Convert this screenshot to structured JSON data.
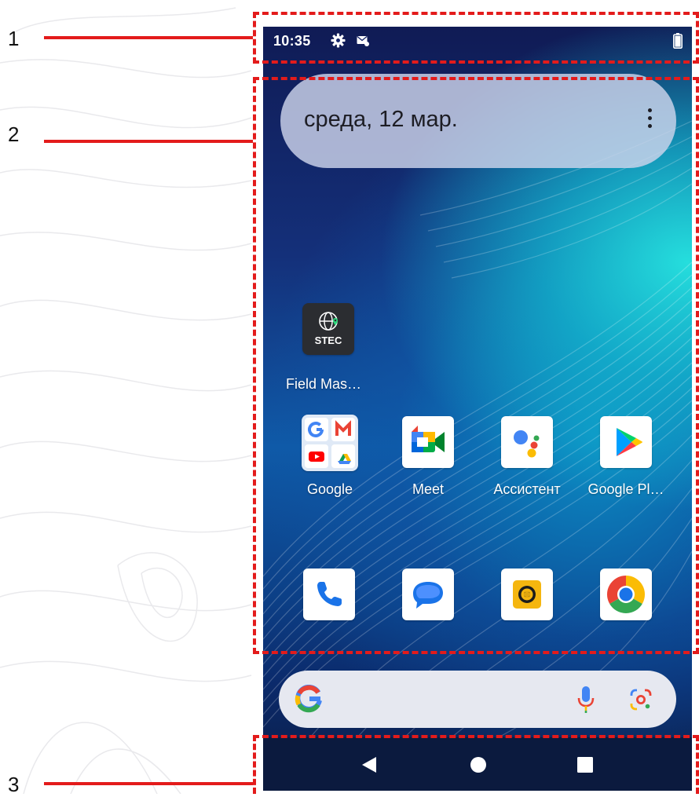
{
  "callouts": [
    "1",
    "2",
    "3"
  ],
  "status_bar": {
    "time": "10:35",
    "icons": [
      "gear-icon",
      "mail-icon",
      "battery-icon"
    ]
  },
  "date_widget": {
    "date": "среда, 12 мар.",
    "menu_icon": "more-vertical-icon"
  },
  "apps": {
    "field_master": {
      "label": "Field Mas…",
      "icon": "stec-field-master-icon",
      "icon_text": "STEC"
    },
    "row1": [
      {
        "label": "Google",
        "icon": "google-folder-icon"
      },
      {
        "label": "Meet",
        "icon": "meet-icon"
      },
      {
        "label": "Ассистент",
        "icon": "assistant-icon"
      },
      {
        "label": "Google Pl…",
        "icon": "play-store-icon"
      }
    ],
    "dock": [
      {
        "icon": "phone-icon"
      },
      {
        "icon": "messages-icon"
      },
      {
        "icon": "camera-icon"
      },
      {
        "icon": "chrome-icon"
      }
    ]
  },
  "search_bar": {
    "icons": [
      "google-g-icon",
      "microphone-icon",
      "lens-icon"
    ]
  },
  "nav_bar": {
    "icons": [
      "back-icon",
      "home-icon",
      "recents-icon"
    ]
  },
  "colors": {
    "callout_red": "#e31b1b",
    "wallpaper_dark": "#101b55",
    "wallpaper_cyan": "#26e6e1"
  }
}
